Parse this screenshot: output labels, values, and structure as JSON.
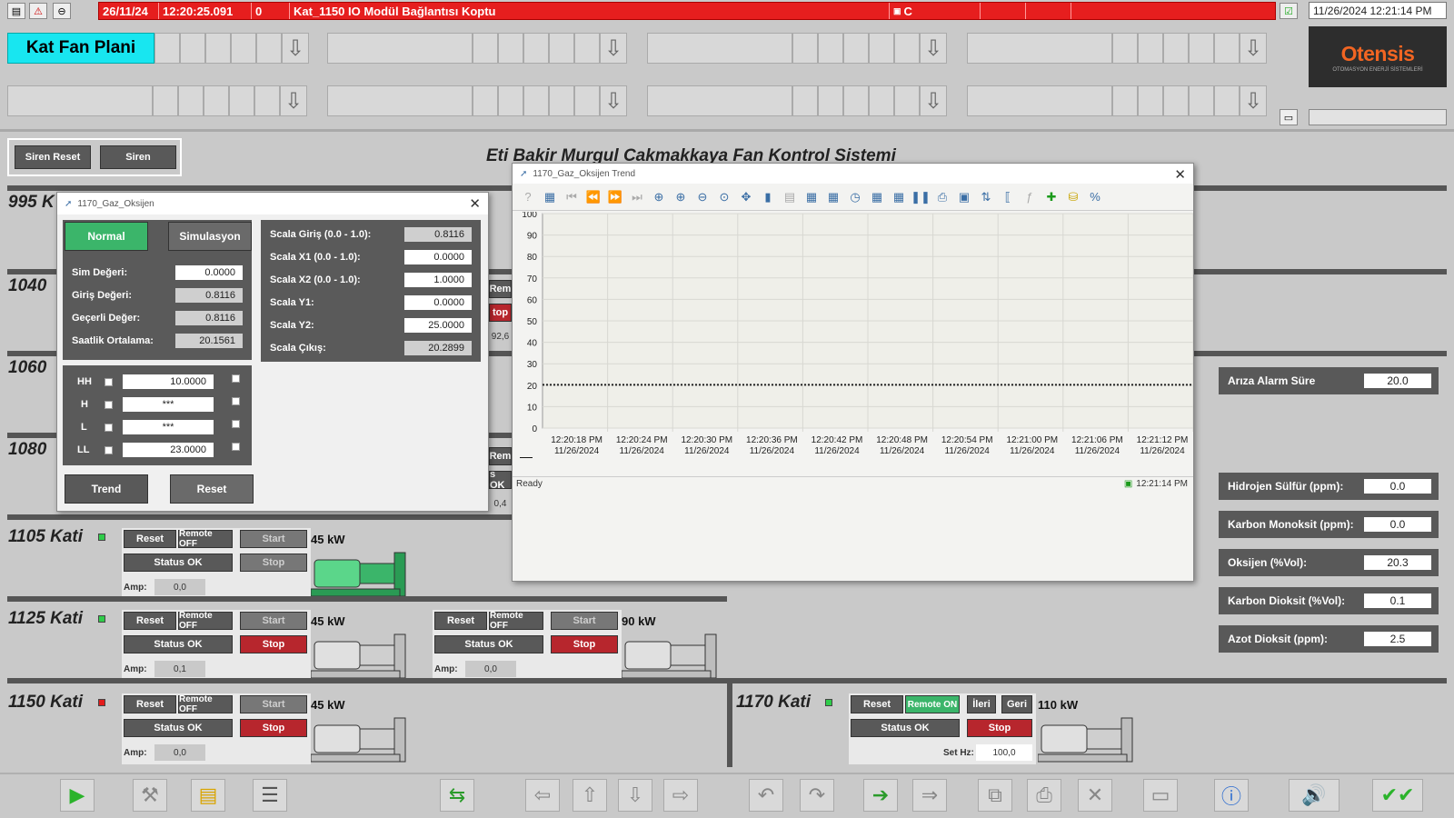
{
  "alarm": {
    "date": "26/11/24",
    "time": "12:20:25.091",
    "code": "0",
    "message": "Kat_1150 IO Modül Bağlantısı Koptu",
    "class": "C"
  },
  "clock": "11/26/2024 12:21:14 PM",
  "plan_button": "Kat Fan Plani",
  "logo": {
    "name": "Otensis",
    "subtitle": "OTOMASYON ENERJİ SİSTEMLERİ"
  },
  "siren": {
    "reset": "Siren Reset",
    "siren": "Siren"
  },
  "title": "Eti Bakir Murgul Cakmakkaya Fan Kontrol Sistemi",
  "floors": {
    "f995": "995 K",
    "f1040": "1040",
    "f1060": "1060",
    "f1080": "1080",
    "f1105": "1105 Kati",
    "f1125": "1125 Kati",
    "f1150": "1150 Kati",
    "f1170": "1170 Kati"
  },
  "fan_labels": {
    "reset": "Reset",
    "remote_off": "Remote OFF",
    "remote_on": "Remote ON",
    "start": "Start",
    "stop": "Stop",
    "status": "Status OK",
    "amp": "Amp:",
    "ileri": "İleri",
    "geri": "Geri",
    "sethz": "Set Hz:"
  },
  "partial": {
    "rem": "Rem",
    "stop": "top",
    "v1": "92,6",
    "s2": "s OK",
    "v2": "0,4"
  },
  "fans": {
    "f1105": {
      "kw": "45 kW",
      "amp": "0,0"
    },
    "f1125a": {
      "kw": "45 kW",
      "amp": "0,1"
    },
    "f1125b": {
      "kw": "90 kW",
      "amp": "0,0"
    },
    "f1150": {
      "kw": "45 kW",
      "amp": "0,0"
    },
    "f1170": {
      "kw": "110 kW",
      "sethz": "100,0"
    }
  },
  "gas": {
    "ariza": {
      "label": "Arıza Alarm Süre",
      "value": "20.0"
    },
    "h2s": {
      "label": "Hidrojen Sülfür (ppm):",
      "value": "0.0"
    },
    "co": {
      "label": "Karbon Monoksit (ppm):",
      "value": "0.0"
    },
    "o2": {
      "label": "Oksijen (%Vol):",
      "value": "20.3"
    },
    "co2": {
      "label": "Karbon Dioksit (%Vol):",
      "value": "0.1"
    },
    "no2": {
      "label": "Azot Dioksit (ppm):",
      "value": "2.5"
    }
  },
  "faceplate": {
    "title": "1170_Gaz_Oksijen",
    "normal": "Normal",
    "simulasyon": "Simulasyon",
    "left": [
      {
        "label": "Sim Değeri:",
        "value": "0.0000"
      },
      {
        "label": "Giriş Değeri:",
        "value": "0.8116"
      },
      {
        "label": "Geçerli Değer:",
        "value": "0.8116"
      },
      {
        "label": "Saatlik Ortalama:",
        "value": "20.1561"
      }
    ],
    "limits": [
      {
        "label": "HH",
        "value": "10.0000"
      },
      {
        "label": "H",
        "value": "***"
      },
      {
        "label": "L",
        "value": "***"
      },
      {
        "label": "LL",
        "value": "23.0000"
      }
    ],
    "scala": [
      {
        "label": "Scala Giriş (0.0 - 1.0):",
        "value": "0.8116"
      },
      {
        "label": "Scala X1 (0.0 - 1.0):",
        "value": "0.0000"
      },
      {
        "label": "Scala X2 (0.0 - 1.0):",
        "value": "1.0000"
      },
      {
        "label": "Scala Y1:",
        "value": "0.0000"
      },
      {
        "label": "Scala Y2:",
        "value": "25.0000"
      },
      {
        "label": "Scala Çıkış:",
        "value": "20.2899"
      }
    ],
    "trend": "Trend",
    "reset": "Reset"
  },
  "trend_window": {
    "title": "1170_Gaz_Oksijen Trend",
    "status": "Ready",
    "status_time": "12:21:14 PM",
    "legend_marker": "—"
  },
  "chart_data": {
    "type": "line",
    "title": "",
    "xlabel": "",
    "ylabel": "",
    "ylim": [
      0,
      100
    ],
    "yticks": [
      0,
      10,
      20,
      30,
      40,
      50,
      60,
      70,
      80,
      90,
      100
    ],
    "x_ticks": [
      {
        "time": "12:20:18 PM",
        "date": "11/26/2024"
      },
      {
        "time": "12:20:24 PM",
        "date": "11/26/2024"
      },
      {
        "time": "12:20:30 PM",
        "date": "11/26/2024"
      },
      {
        "time": "12:20:36 PM",
        "date": "11/26/2024"
      },
      {
        "time": "12:20:42 PM",
        "date": "11/26/2024"
      },
      {
        "time": "12:20:48 PM",
        "date": "11/26/2024"
      },
      {
        "time": "12:20:54 PM",
        "date": "11/26/2024"
      },
      {
        "time": "12:21:00 PM",
        "date": "11/26/2024"
      },
      {
        "time": "12:21:06 PM",
        "date": "11/26/2024"
      },
      {
        "time": "12:21:12 PM",
        "date": "11/26/2024"
      }
    ],
    "series": [
      {
        "values": [
          20.2,
          20.2,
          20.2,
          20.2,
          20.2,
          20.2,
          20.2,
          20.2,
          20.2,
          20.2,
          20.2
        ]
      }
    ],
    "grid": true,
    "line_color": "#222222"
  },
  "colors": {
    "alarm": "#e61e1e",
    "accent": "#18e6f0",
    "normal": "#3bb56a",
    "stop": "#b7262d",
    "dark": "#595959"
  }
}
